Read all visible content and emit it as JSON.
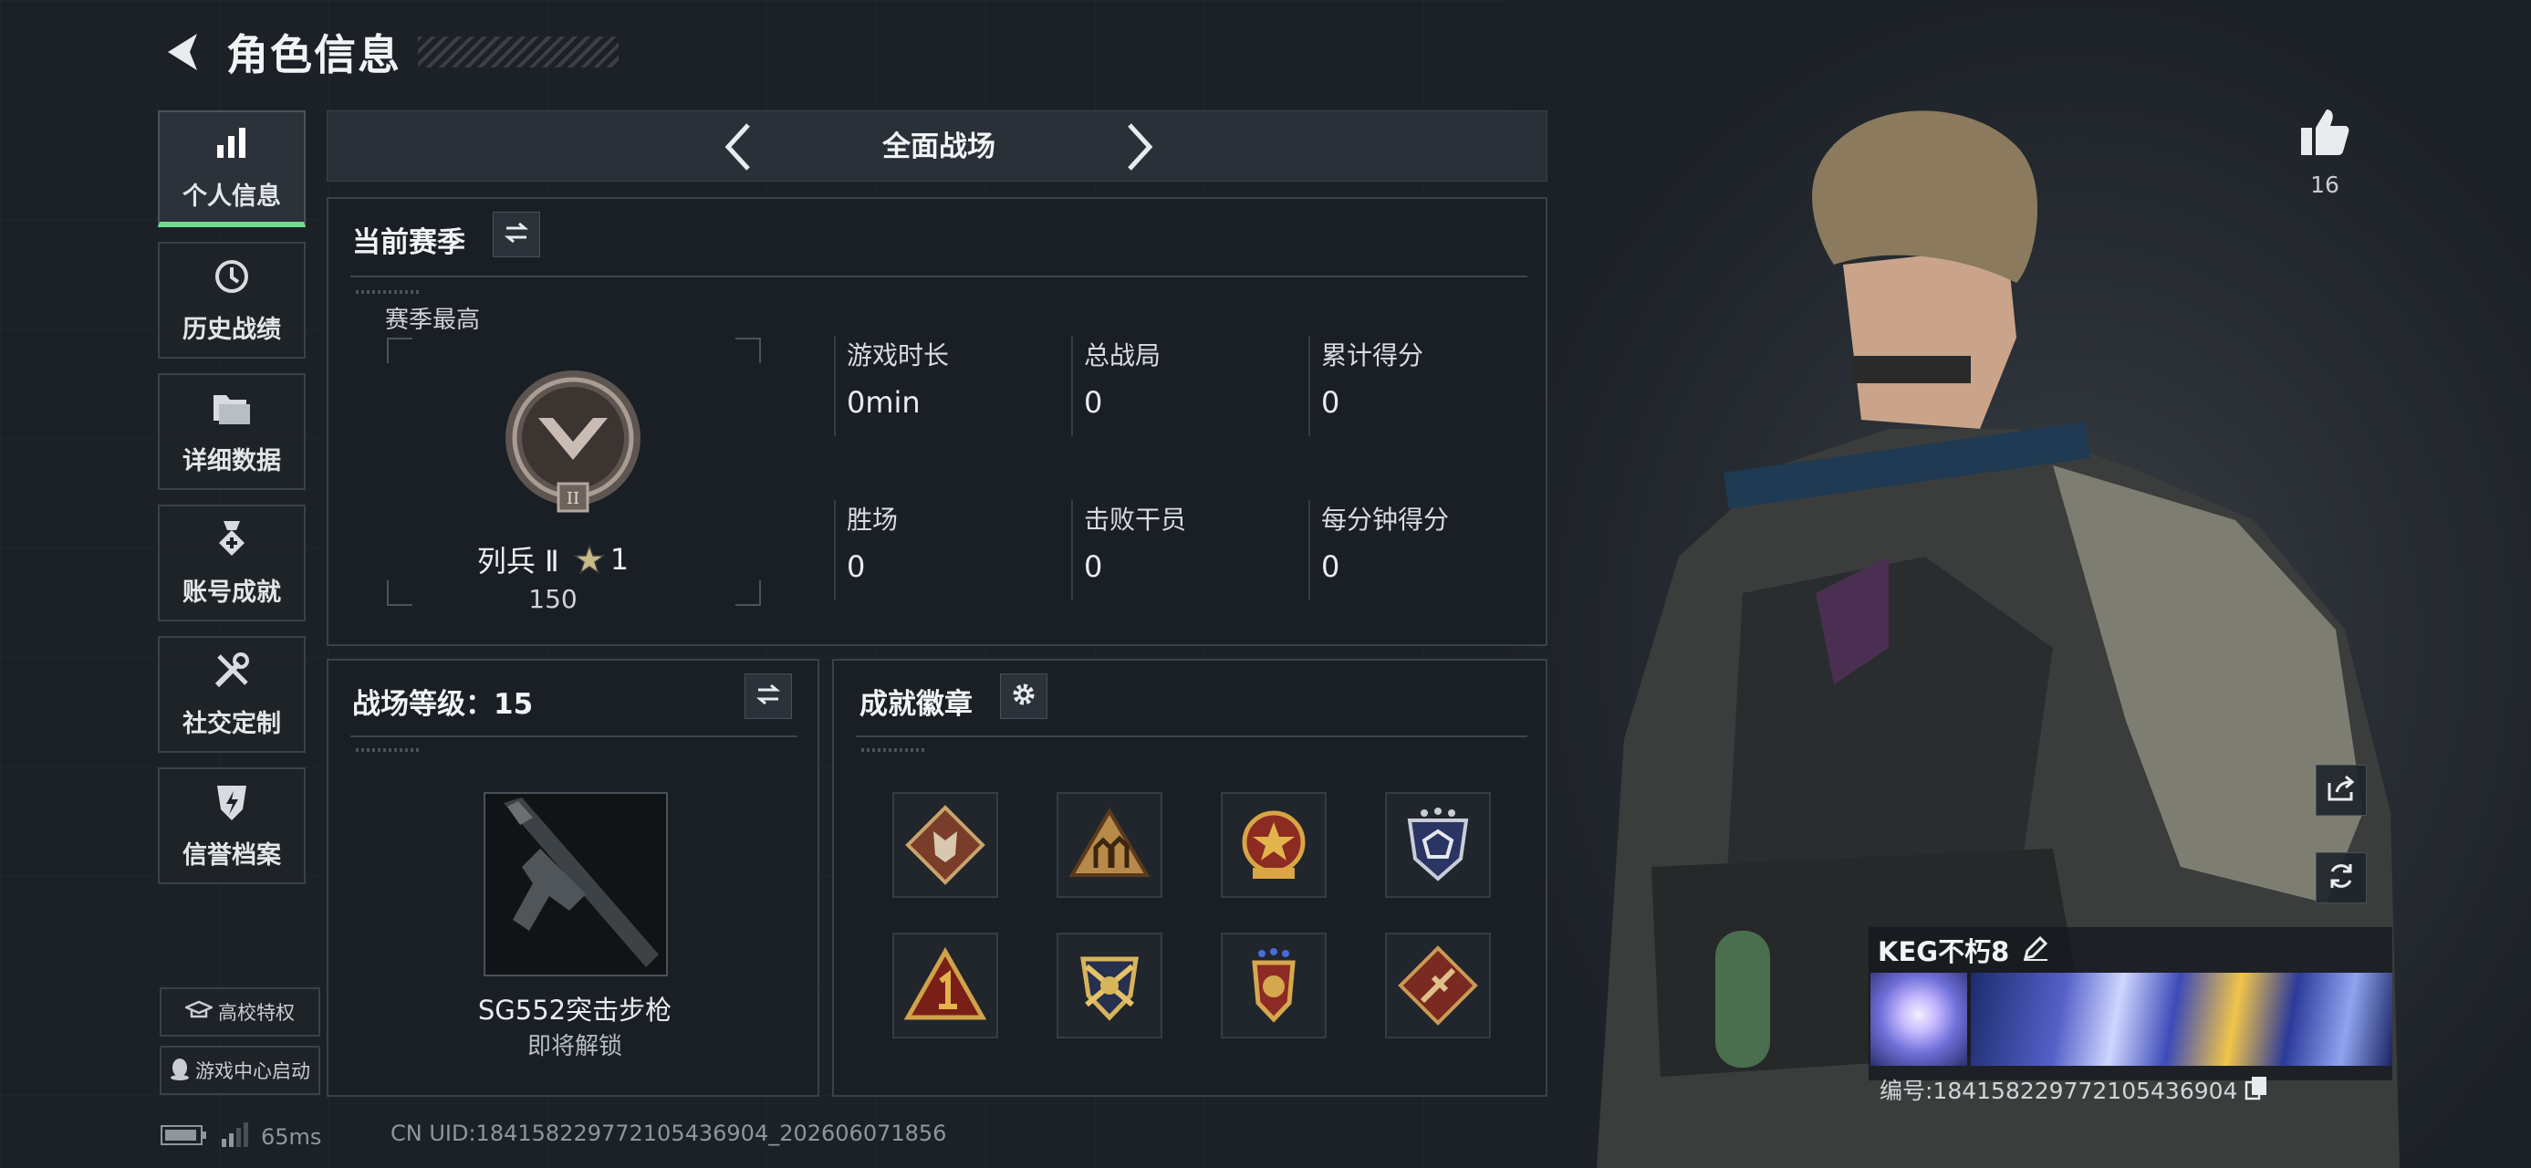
{
  "header": {
    "title": "角色信息"
  },
  "sidebar": {
    "items": [
      {
        "label": "个人信息",
        "icon": "bar-chart-icon",
        "active": true
      },
      {
        "label": "历史战绩",
        "icon": "history-clock-icon"
      },
      {
        "label": "详细数据",
        "icon": "folder-icon"
      },
      {
        "label": "账号成就",
        "icon": "medal-icon"
      },
      {
        "label": "社交定制",
        "icon": "tools-icon"
      },
      {
        "label": "信誉档案",
        "icon": "shield-bolt-icon"
      }
    ],
    "campus_label": "高校特权",
    "launch_label": "游戏中心启动"
  },
  "mode": {
    "label": "全面战场"
  },
  "season": {
    "title": "当前赛季",
    "best_label": "赛季最高",
    "rank_name": "列兵 Ⅱ",
    "rank_stars": "1",
    "rank_points": "150",
    "rank_numeral": "II",
    "stats": [
      {
        "label": "游戏时长",
        "value": "0min"
      },
      {
        "label": "总战局",
        "value": "0"
      },
      {
        "label": "累计得分",
        "value": "0"
      },
      {
        "label": "胜场",
        "value": "0"
      },
      {
        "label": "击败干员",
        "value": "0"
      },
      {
        "label": "每分钟得分",
        "value": "0"
      }
    ]
  },
  "level": {
    "title": "战场等级：15",
    "weapon_name": "SG552突击步枪",
    "weapon_status": "即将解锁"
  },
  "badges": {
    "title": "成就徽章",
    "items": [
      {
        "icon": "wolf-badge-icon"
      },
      {
        "icon": "soldiers-badge-icon"
      },
      {
        "icon": "star-emblem-badge-icon"
      },
      {
        "icon": "shield-stars-badge-icon"
      },
      {
        "icon": "number-one-badge-icon"
      },
      {
        "icon": "crossed-rifles-badge-icon"
      },
      {
        "icon": "winged-emblem-badge-icon"
      },
      {
        "icon": "rifle-diamond-badge-icon"
      }
    ]
  },
  "profile": {
    "likes": "16",
    "player_name": "KEG不朽8",
    "player_id": "编号:18415822977210543690​4"
  },
  "status": {
    "ping": "65ms",
    "uid": "CN UID:18415822977210543690​4_202606071856"
  },
  "colors": {
    "accent_green": "#6fdc8c",
    "panel_border": "#3a4149",
    "background": "#1c2127"
  }
}
